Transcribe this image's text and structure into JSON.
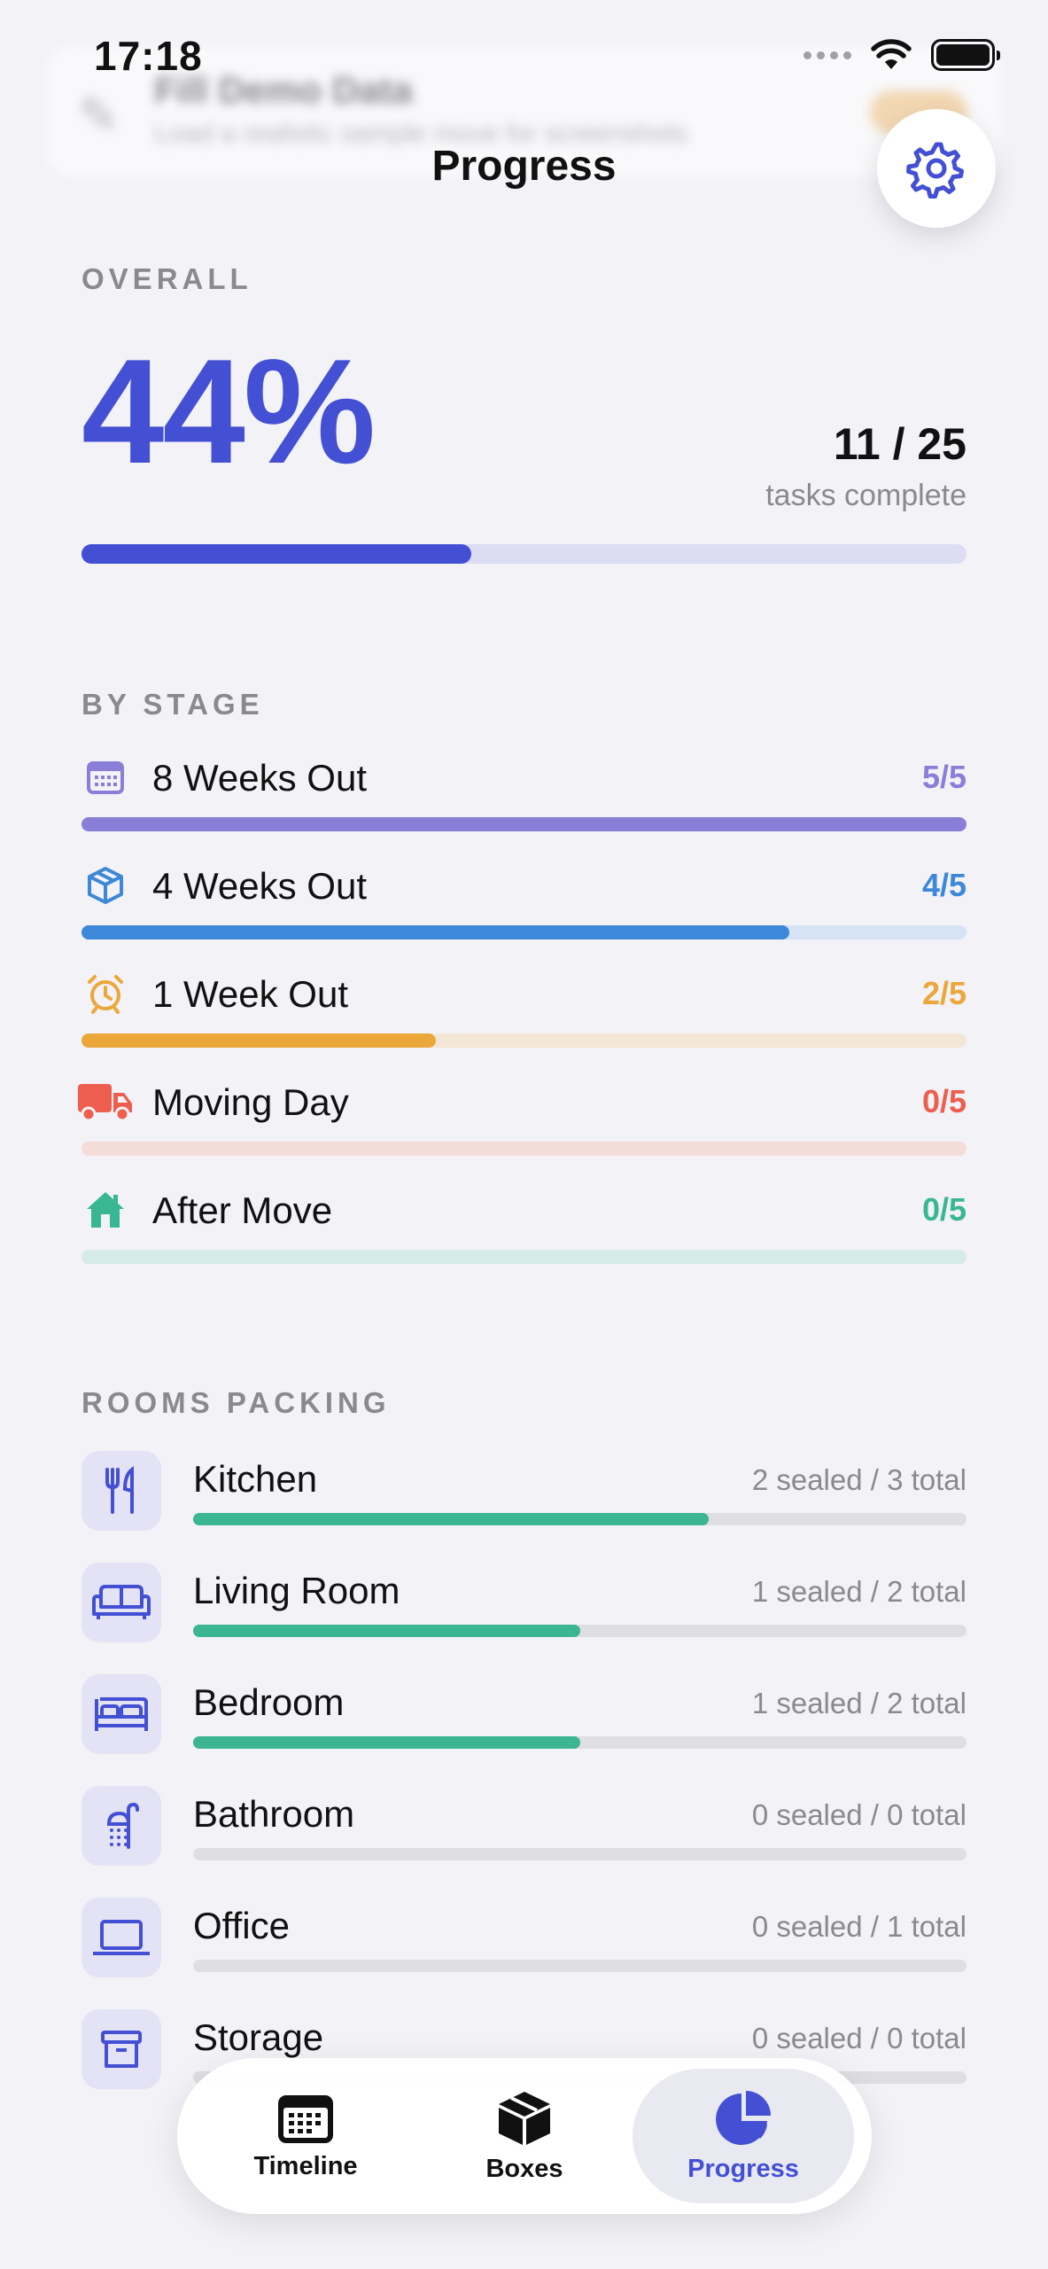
{
  "status_bar": {
    "time": "17:18"
  },
  "banner": {
    "title": "Fill Demo Data",
    "subtitle": "Load a realistic sample move for screenshots"
  },
  "header": {
    "title": "Progress"
  },
  "overall": {
    "section_label": "OVERALL",
    "percent_text": "44%",
    "progress": 0.44,
    "count_text": "11 / 25",
    "caption": "tasks complete"
  },
  "stages": {
    "section_label": "BY STAGE",
    "items": [
      {
        "label": "8 Weeks Out",
        "count": "5/5",
        "done": 5,
        "total": 5,
        "color": "#8a7fd8",
        "track": "#e6e2f5",
        "icon": "calendar-icon"
      },
      {
        "label": "4 Weeks Out",
        "count": "4/5",
        "done": 4,
        "total": 5,
        "color": "#3d88d8",
        "track": "#d6e3f4",
        "icon": "box-icon"
      },
      {
        "label": "1 Week Out",
        "count": "2/5",
        "done": 2,
        "total": 5,
        "color": "#eba73a",
        "track": "#f3e6d6",
        "icon": "alarm-clock-icon"
      },
      {
        "label": "Moving Day",
        "count": "0/5",
        "done": 0,
        "total": 5,
        "color": "#ee5e4f",
        "track": "#f4dcd9",
        "icon": "truck-icon"
      },
      {
        "label": "After Move",
        "count": "0/5",
        "done": 0,
        "total": 5,
        "color": "#39b795",
        "track": "#d5ebe7",
        "icon": "house-icon"
      }
    ]
  },
  "rooms": {
    "section_label": "ROOMS PACKING",
    "items": [
      {
        "label": "Kitchen",
        "meta": "2 sealed / 3 total",
        "sealed": 2,
        "total": 3,
        "icon": "fork-knife-icon"
      },
      {
        "label": "Living Room",
        "meta": "1 sealed / 2 total",
        "sealed": 1,
        "total": 2,
        "icon": "sofa-icon"
      },
      {
        "label": "Bedroom",
        "meta": "1 sealed / 2 total",
        "sealed": 1,
        "total": 2,
        "icon": "bed-icon"
      },
      {
        "label": "Bathroom",
        "meta": "0 sealed / 0 total",
        "sealed": 0,
        "total": 0,
        "icon": "shower-icon"
      },
      {
        "label": "Office",
        "meta": "0 sealed / 1 total",
        "sealed": 0,
        "total": 1,
        "icon": "laptop-icon"
      },
      {
        "label": "Storage",
        "meta": "0 sealed / 0 total",
        "sealed": 0,
        "total": 0,
        "icon": "archive-box-icon"
      }
    ]
  },
  "tabs": [
    {
      "label": "Timeline",
      "icon": "calendar-icon",
      "active": false
    },
    {
      "label": "Boxes",
      "icon": "box-icon",
      "active": false
    },
    {
      "label": "Progress",
      "icon": "pie-chart-icon",
      "active": true
    }
  ],
  "colors": {
    "accent": "#4350d4",
    "room_fill": "#3bb592"
  }
}
